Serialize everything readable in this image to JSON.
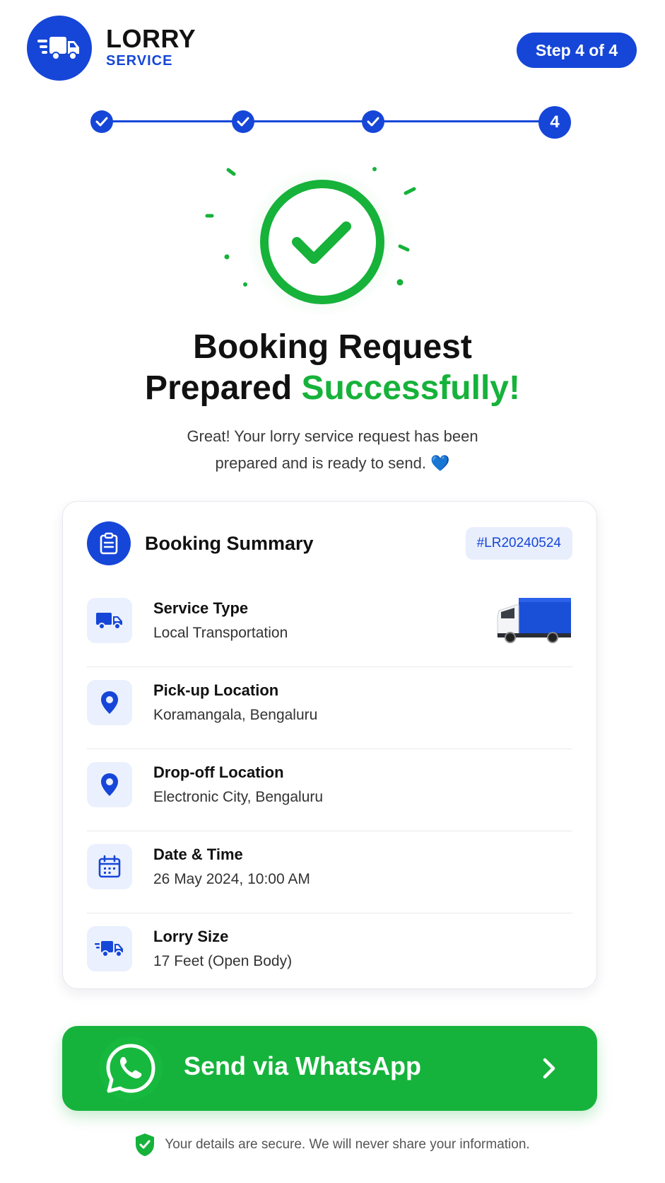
{
  "brand": {
    "name": "LORRY",
    "sub": "SERVICE"
  },
  "step_indicator": "Step 4 of 4",
  "progress": {
    "completed_steps": 3,
    "current_step": "4"
  },
  "headline": {
    "line1": "Booking Request",
    "line2_a": "Prepared ",
    "line2_b": "Successfully!"
  },
  "subtext": {
    "line1": "Great! Your lorry service request has been",
    "line2": "prepared and is ready to send.",
    "emoji": "💙"
  },
  "summary": {
    "title": "Booking Summary",
    "booking_id": "#LR20240524",
    "rows": [
      {
        "label": "Service Type",
        "value": "Local Transportation",
        "icon": "truck-icon"
      },
      {
        "label": "Pick-up Location",
        "value": "Koramangala, Bengaluru",
        "icon": "location-pin-icon"
      },
      {
        "label": "Drop-off Location",
        "value": "Electronic City, Bengaluru",
        "icon": "location-pin-icon"
      },
      {
        "label": "Date & Time",
        "value": "26 May 2024, 10:00 AM",
        "icon": "calendar-icon"
      },
      {
        "label": "Lorry Size",
        "value": "17 Feet (Open Body)",
        "icon": "fast-truck-icon"
      }
    ]
  },
  "whatsapp_button": "Send via WhatsApp",
  "secure_note": "Your details are secure. We will never share your information.",
  "colors": {
    "primary": "#1646d8",
    "success": "#16b23a",
    "whatsapp": "#16b33c"
  }
}
